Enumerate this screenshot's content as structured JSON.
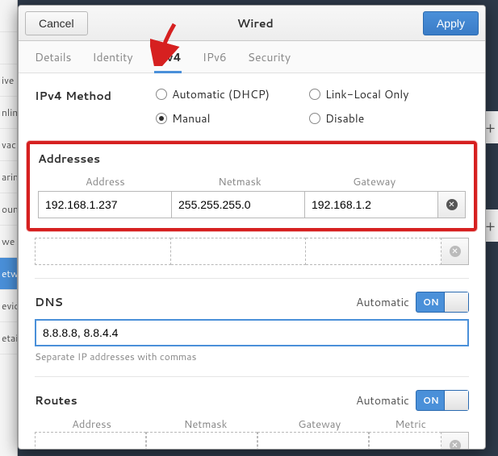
{
  "sidebar": {
    "items": [
      "ive",
      "nlin",
      "vac",
      "arin",
      "oun",
      "we",
      "etw",
      "evic",
      "etail"
    ]
  },
  "titlebar": {
    "cancel": "Cancel",
    "title": "Wired",
    "apply": "Apply"
  },
  "tabs": {
    "details": "Details",
    "identity": "Identity",
    "ipv4": "IPv4",
    "ipv6": "IPv6",
    "security": "Security"
  },
  "method": {
    "label": "IPv4 Method",
    "automatic": "Automatic (DHCP)",
    "linklocal": "Link-Local Only",
    "manual": "Manual",
    "disable": "Disable",
    "selected": "manual"
  },
  "addresses": {
    "title": "Addresses",
    "headers": {
      "address": "Address",
      "netmask": "Netmask",
      "gateway": "Gateway"
    },
    "rows": [
      {
        "address": "192.168.1.237",
        "netmask": "255.255.255.0",
        "gateway": "192.168.1.2"
      }
    ]
  },
  "dns": {
    "title": "DNS",
    "automatic_label": "Automatic",
    "switch_text": "ON",
    "value": "8.8.8.8, 8.8.4.4",
    "hint": "Separate IP addresses with commas"
  },
  "routes": {
    "title": "Routes",
    "automatic_label": "Automatic",
    "switch_text": "ON",
    "headers": {
      "address": "Address",
      "netmask": "Netmask",
      "gateway": "Gateway",
      "metric": "Metric"
    }
  }
}
